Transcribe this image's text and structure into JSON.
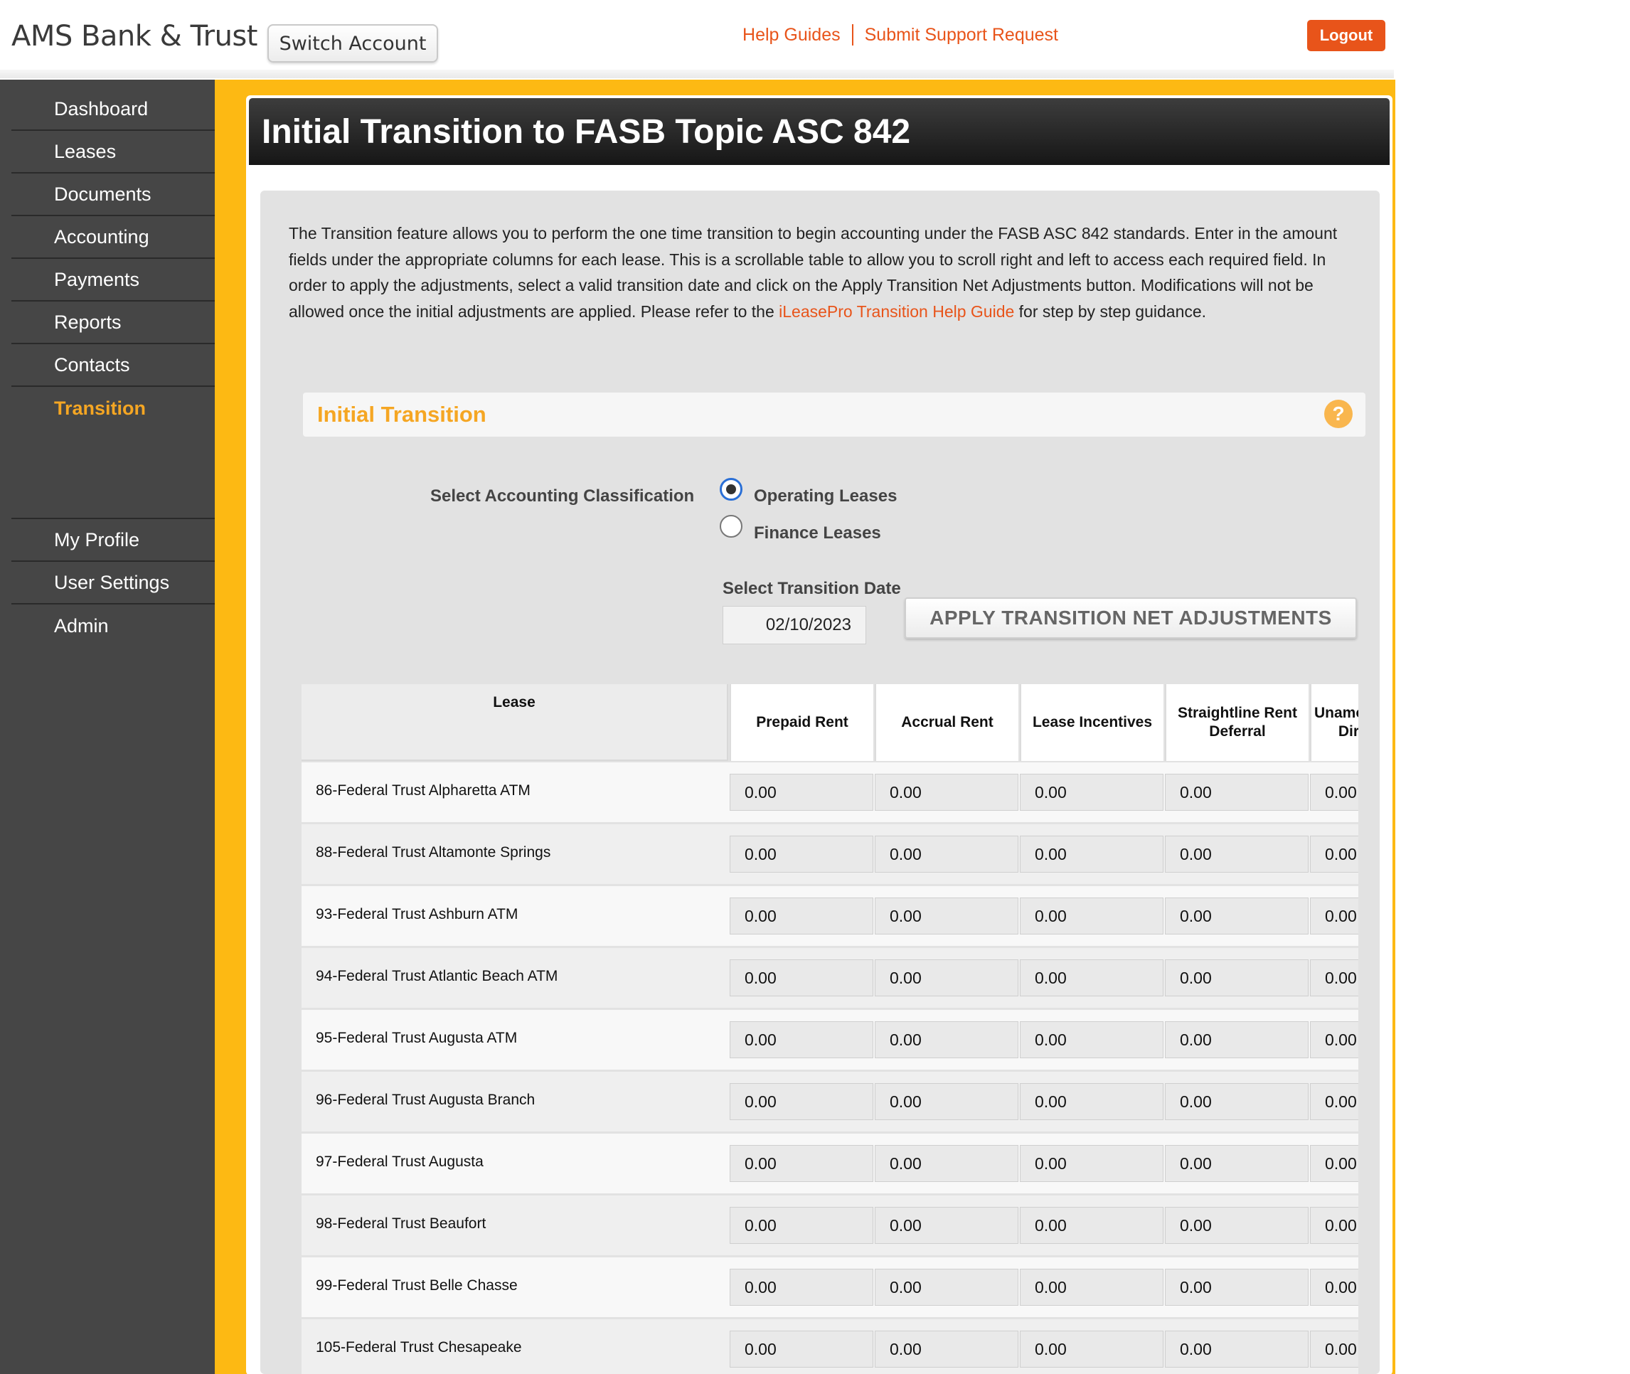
{
  "header": {
    "brand": "AMS Bank & Trust",
    "switch_account": "Switch Account",
    "help_guides": "Help Guides",
    "submit_support": "Submit Support Request",
    "logout": "Logout"
  },
  "sidebar": {
    "items": [
      "Dashboard",
      "Leases",
      "Documents",
      "Accounting",
      "Payments",
      "Reports",
      "Contacts",
      "Transition"
    ],
    "active": "Transition",
    "lower_items": [
      "My Profile",
      "User Settings",
      "Admin"
    ]
  },
  "page": {
    "title": "Initial Transition to FASB Topic ASC 842",
    "intro_before_link": "The Transition feature allows you to perform the one time transition to begin accounting under the FASB ASC 842 standards. Enter in the amount fields under the appropriate columns for each lease. This is a scrollable table to allow you to scroll right and left to access each required field. In order to apply the adjustments, select a valid transition date and click on the Apply Transition Net Adjustments button. Modifications will not be allowed once the initial adjustments are applied. Please refer to the ",
    "intro_link": "iLeasePro Transition Help Guide",
    "intro_after_link": " for step by step guidance.",
    "section_title": "Initial Transition",
    "help_icon": "?"
  },
  "form": {
    "classification_label": "Select Accounting Classification",
    "options": [
      "Operating Leases",
      "Finance Leases"
    ],
    "selected_option": "Operating Leases",
    "date_label": "Select Transition Date",
    "date_value": "02/10/2023",
    "apply_button": "APPLY TRANSITION NET ADJUSTMENTS"
  },
  "table": {
    "lease_header": "Lease",
    "columns": [
      "Prepaid Rent",
      "Accrual Rent",
      "Lease Incentives",
      "Straightline Rent\nDeferral",
      "Unamortized\nDirect"
    ],
    "rows": [
      {
        "lease": "86-Federal Trust Alpharetta ATM",
        "values": [
          "0.00",
          "0.00",
          "0.00",
          "0.00",
          "0.00"
        ]
      },
      {
        "lease": "88-Federal Trust Altamonte Springs",
        "values": [
          "0.00",
          "0.00",
          "0.00",
          "0.00",
          "0.00"
        ]
      },
      {
        "lease": "93-Federal Trust Ashburn ATM",
        "values": [
          "0.00",
          "0.00",
          "0.00",
          "0.00",
          "0.00"
        ]
      },
      {
        "lease": "94-Federal Trust Atlantic Beach ATM",
        "values": [
          "0.00",
          "0.00",
          "0.00",
          "0.00",
          "0.00"
        ]
      },
      {
        "lease": "95-Federal Trust Augusta ATM",
        "values": [
          "0.00",
          "0.00",
          "0.00",
          "0.00",
          "0.00"
        ]
      },
      {
        "lease": "96-Federal Trust Augusta Branch",
        "values": [
          "0.00",
          "0.00",
          "0.00",
          "0.00",
          "0.00"
        ]
      },
      {
        "lease": "97-Federal Trust Augusta",
        "values": [
          "0.00",
          "0.00",
          "0.00",
          "0.00",
          "0.00"
        ]
      },
      {
        "lease": "98-Federal Trust Beaufort",
        "values": [
          "0.00",
          "0.00",
          "0.00",
          "0.00",
          "0.00"
        ]
      },
      {
        "lease": "99-Federal Trust Belle Chasse",
        "values": [
          "0.00",
          "0.00",
          "0.00",
          "0.00",
          "0.00"
        ]
      },
      {
        "lease": "105-Federal Trust Chesapeake",
        "values": [
          "0.00",
          "0.00",
          "0.00",
          "0.00",
          "0.00"
        ]
      }
    ]
  },
  "colors": {
    "accent_orange": "#e8541a",
    "nav_active": "#f5a623",
    "frame_yellow": "#fdb913",
    "sidebar_bg": "#464646"
  }
}
